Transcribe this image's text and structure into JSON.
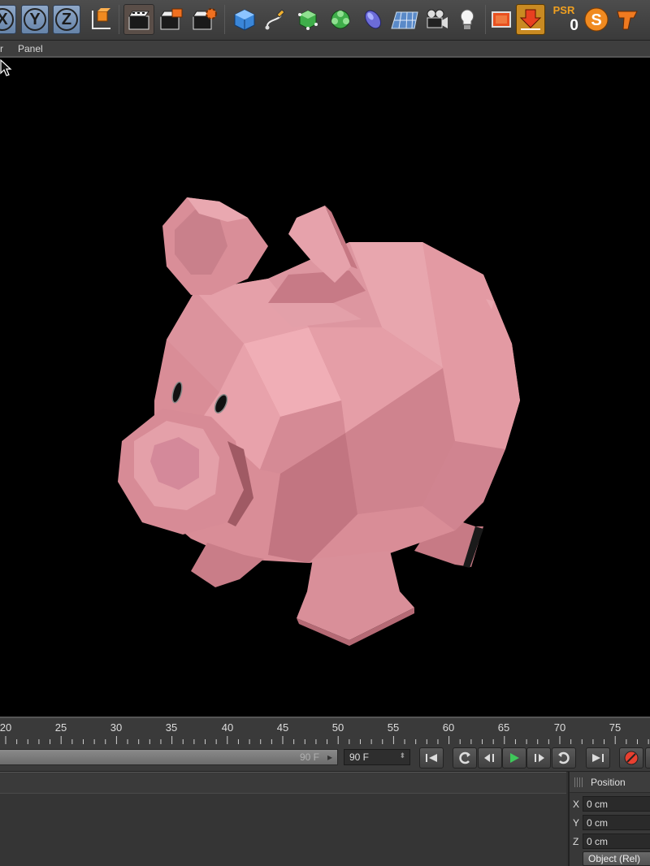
{
  "toolbar": {
    "axes": [
      "X",
      "Y",
      "Z"
    ],
    "psr_label": "PSR",
    "psr_value": "0",
    "icons": [
      "coordinate-system-icon",
      "render-view-icon",
      "render-picture-viewer-icon",
      "render-settings-icon",
      "cube-icon",
      "spline-pen-icon",
      "generator-icon",
      "deformer-icon",
      "scene-object-icon",
      "floor-icon",
      "camera-icon",
      "light-icon",
      "display-icon",
      "import-icon",
      "sculpt-icon",
      "tool-icon"
    ]
  },
  "menubar": {
    "items": [
      "r",
      "Panel"
    ]
  },
  "timeline": {
    "ruler_labels": [
      "20",
      "25",
      "30",
      "35",
      "40",
      "45",
      "50",
      "55",
      "60",
      "65",
      "70",
      "75"
    ],
    "slider_end": "90 F",
    "end_frame": "90 F",
    "transport_icons": [
      "go-to-start-icon",
      "loop-icon",
      "prev-key-icon",
      "play-icon",
      "next-key-icon",
      "repeat-icon",
      "go-to-end-icon",
      "record-icon"
    ]
  },
  "attributes": {
    "title": "Position",
    "rows": [
      {
        "axis": "X",
        "value": "0 cm"
      },
      {
        "axis": "Y",
        "value": "0 cm"
      },
      {
        "axis": "Z",
        "value": "0 cm"
      }
    ],
    "mode": "Object (Rel)"
  },
  "colors": {
    "pig": "#d88893",
    "viewport": "#000000",
    "ui": "#3a3a3a"
  }
}
